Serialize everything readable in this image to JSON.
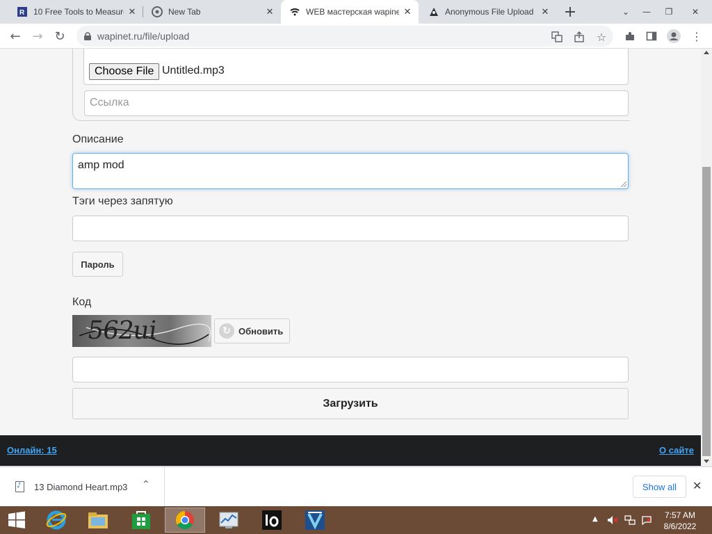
{
  "browser": {
    "tabs": [
      {
        "title": "10 Free Tools to Measure",
        "icon": "r-logo-icon",
        "active": false
      },
      {
        "title": "New Tab",
        "icon": "chrome-icon",
        "active": false
      },
      {
        "title": "WEB мастерская wapine",
        "icon": "wapinet-icon",
        "active": true
      },
      {
        "title": "Anonymous File Upload",
        "icon": "anon-upload-icon",
        "active": false
      }
    ],
    "url": "wapinet.ru/file/upload"
  },
  "form": {
    "choose_file_label": "Choose File",
    "file_name": "Untitled.mp3",
    "link_placeholder": "Ссылка",
    "description_label": "Описание",
    "description_value": "amp mod",
    "tags_label": "Тэги через запятую",
    "tags_value": "",
    "password_button": "Пароль",
    "code_label": "Код",
    "captcha_text": "562ui",
    "refresh_button": "Обновить",
    "code_value": "",
    "upload_button": "Загрузить"
  },
  "footer": {
    "online": "Онлайн: 15",
    "about": "О сайте"
  },
  "download_bar": {
    "file_name": "13 Diamond Heart.mp3",
    "show_all": "Show all"
  },
  "taskbar": {
    "time": "7:57 AM",
    "date": "8/6/2022"
  },
  "colors": {
    "accent_link": "#42a5f5",
    "focus_border": "#66afe9",
    "footer_bg": "#1d1f21",
    "taskbar_bg": "#6b4a36"
  }
}
